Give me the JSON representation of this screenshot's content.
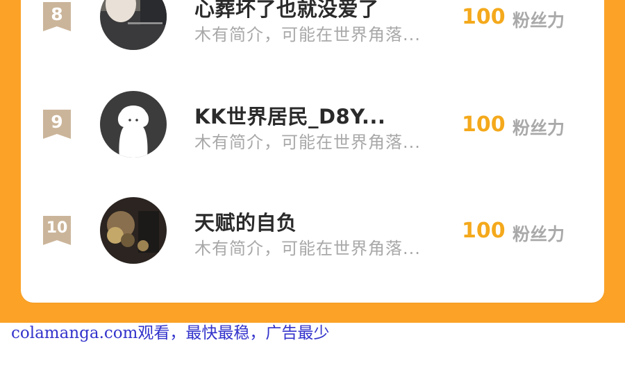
{
  "ranking": {
    "entries": [
      {
        "rank": "8",
        "name": "心葬坏了也就没爱了",
        "bio": "木有简介，可能在世界角落...",
        "score": "100",
        "score_unit": "粉丝力"
      },
      {
        "rank": "9",
        "name": "KK世界居民_D8Y...",
        "bio": "木有简介，可能在世界角落...",
        "score": "100",
        "score_unit": "粉丝力"
      },
      {
        "rank": "10",
        "name": "天赋的自负",
        "bio": "木有简介，可能在世界角落...",
        "score": "100",
        "score_unit": "粉丝力"
      }
    ]
  },
  "watermark": {
    "text": "colamanga.com观看，最快最稳，广告最少"
  },
  "colors": {
    "frame": "#fba227",
    "score": "#f4a91c",
    "badge": "#cbb59a",
    "name": "#2a2a2a",
    "bio": "#a8a8a8",
    "watermark": "#3333cc"
  },
  "icons": {
    "rank_badge": "ribbon-badge-icon",
    "default_avatar": "ghost-avatar-icon"
  }
}
